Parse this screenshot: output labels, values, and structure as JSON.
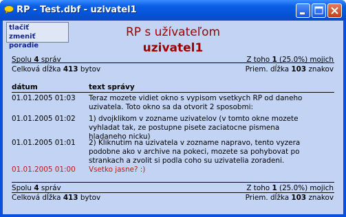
{
  "window": {
    "title": "RP - Test.dbf - uzivatel1"
  },
  "buttons": {
    "print": "tlačiť",
    "reorder": "zmeniť poradie"
  },
  "header": {
    "line1": "RP s užívateľom",
    "user": "uzivatel1"
  },
  "stats_top": {
    "total_prefix": "Spolu",
    "total_count": "4",
    "total_suffix": "správ",
    "of_prefix": "Z toho",
    "of_count": "1",
    "of_suffix": "(25.0%) mojich",
    "len_prefix": "Celková dĺžka",
    "len_value": "413",
    "len_suffix": "bytov",
    "avg_prefix": "Priem. dĺžka",
    "avg_value": "103",
    "avg_suffix": "znakov"
  },
  "table": {
    "col_date": "dátum",
    "col_text": "text správy",
    "rows": [
      {
        "date": "01.01.2005 01:03",
        "lines": [
          "Teraz mozete vidiet okno s vypisom vsetkych RP od daneho",
          "uzivatela. Toto okno sa da otvorit 2 sposobmi:"
        ]
      },
      {
        "date": "01.01.2005 01:02",
        "lines": [
          "1) dvojklikom v zozname uzivatelov (v tomto okne mozete",
          "vyhladat tak, ze postupne pisete zaciatocne pismena",
          "hladaneho nicku)"
        ]
      },
      {
        "date": "01.01.2005 01:01",
        "lines": [
          "2) Kliknutim na uzivatela v zozname napravo, tento vyzera",
          "podobne ako v archive na pokeci, mozete sa pohybovat po",
          "strankach a zvolit si podla coho su uzivatelia zoradeni."
        ]
      },
      {
        "date": "01.01.2005 01:00",
        "lines": [
          "Vsetko jasne? :)"
        ]
      }
    ]
  },
  "stats_bottom": {
    "total_prefix": "Spolu",
    "total_count": "4",
    "total_suffix": "správ",
    "of_prefix": "Z toho",
    "of_count": "1",
    "of_suffix": "(25.0%) mojich",
    "len_prefix": "Celková dĺžka",
    "len_value": "413",
    "len_suffix": "bytov",
    "avg_prefix": "Priem. dĺžka",
    "avg_value": "103",
    "avg_suffix": "znakov"
  },
  "colors": {
    "own_message": "#b81a1a",
    "header": "#a00000",
    "background": "#c3d3f3"
  },
  "icons": {
    "app": "speech-bubble-icon",
    "minimize": "minimize-icon",
    "maximize": "maximize-icon",
    "close": "close-icon"
  }
}
